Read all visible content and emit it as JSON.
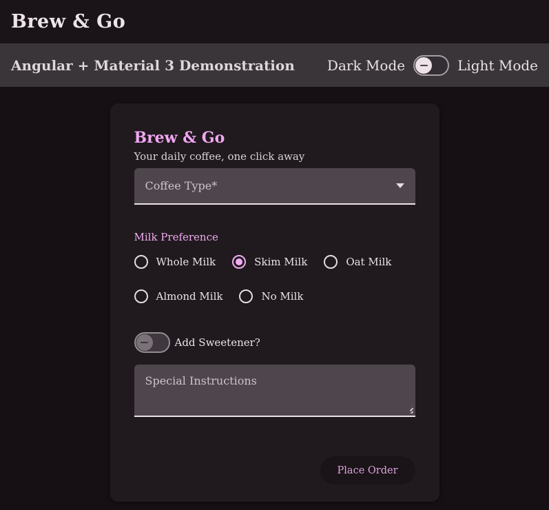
{
  "app": {
    "title": "Brew & Go"
  },
  "toolbar": {
    "subtitle": "Angular + Material 3 Demonstration",
    "dark_mode_label": "Dark Mode",
    "light_mode_label": "Light Mode",
    "theme_toggle_state": "off"
  },
  "card": {
    "title": "Brew & Go",
    "subtitle": "Your daily coffee, one click away",
    "coffee_type": {
      "label": "Coffee Type*",
      "value": "",
      "type": "select"
    },
    "milk_preference": {
      "label": "Milk Preference",
      "options": [
        "Whole Milk",
        "Skim Milk",
        "Oat Milk",
        "Almond Milk",
        "No Milk"
      ],
      "selected": "Skim Milk"
    },
    "sweetener": {
      "label": "Add Sweetener?",
      "state": "off"
    },
    "special_instructions": {
      "label": "Special Instructions",
      "value": ""
    },
    "submit_label": "Place Order"
  },
  "colors": {
    "accent_pink": "#f2acf2",
    "header_bg": "#1a1317",
    "subheader_bg": "#3a3539",
    "page_bg": "#161014",
    "card_bg": "#201a1e",
    "field_bg": "#4e464c",
    "button_text": "#dba3de"
  }
}
